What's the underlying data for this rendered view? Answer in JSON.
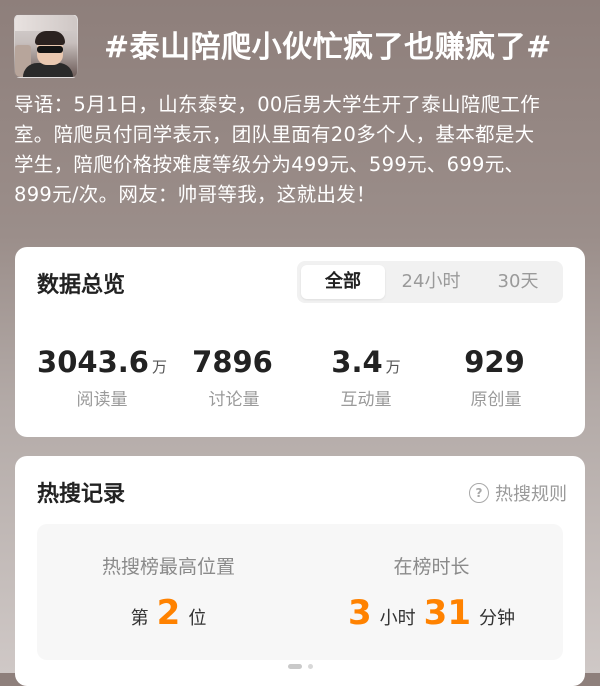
{
  "topic": {
    "title": "#泰山陪爬小伙忙疯了也赚疯了#",
    "intro_lines": [
      "导语：5月1日，山东泰安，00后男大学生开了泰山陪爬工作",
      "室。陪爬员付同学表示，团队里面有20多个人，基本都是大",
      "学生，陪爬价格按难度等级分为499元、599元、699元、",
      "899元/次。网友：帅哥等我，这就出发！"
    ]
  },
  "overview": {
    "title": "数据总览",
    "tabs": [
      {
        "label": "全部",
        "active": true
      },
      {
        "label": "24小时",
        "active": false
      },
      {
        "label": "30天",
        "active": false
      }
    ],
    "stats": [
      {
        "value": "3043.6",
        "unit": "万",
        "label": "阅读量"
      },
      {
        "value": "7896",
        "unit": "",
        "label": "讨论量"
      },
      {
        "value": "3.4",
        "unit": "万",
        "label": "互动量"
      },
      {
        "value": "929",
        "unit": "",
        "label": "原创量"
      }
    ]
  },
  "hot_search": {
    "title": "热搜记录",
    "rules_label": "热搜规则",
    "help_icon": "question-circle-icon",
    "highest_position": {
      "caption": "热搜榜最高位置",
      "prefix": "第",
      "value": "2",
      "suffix": "位"
    },
    "duration": {
      "caption": "在榜时长",
      "hours": "3",
      "hours_unit": "小时",
      "minutes": "31",
      "minutes_unit": "分钟"
    }
  },
  "colors": {
    "accent_orange": "#ff8200",
    "card_bg": "#ffffff",
    "muted_text": "#9a9a9a"
  }
}
